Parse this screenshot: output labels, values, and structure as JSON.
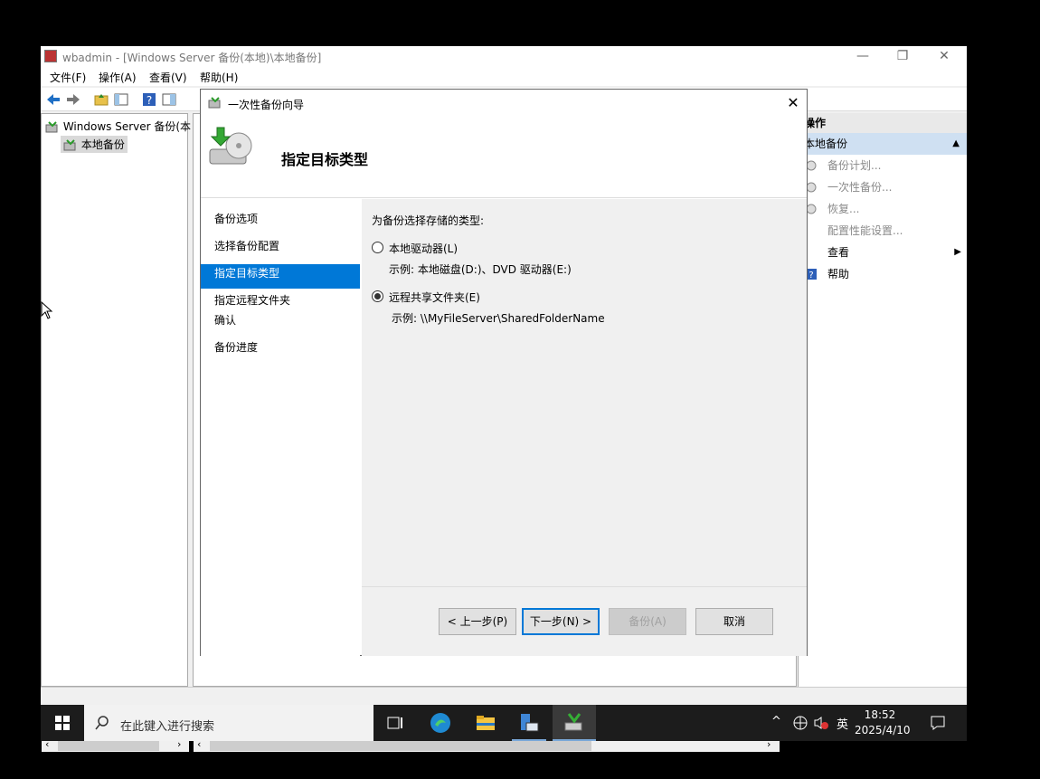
{
  "window": {
    "title": "wbadmin - [Windows Server 备份(本地)\\本地备份]",
    "minimize": "—",
    "restore": "❐",
    "close": "✕"
  },
  "menubar": [
    "文件(F)",
    "操作(A)",
    "查看(V)",
    "帮助(H)"
  ],
  "tree": {
    "root": "Windows Server 备份(本",
    "child": "本地备份"
  },
  "actions": {
    "header": "操作",
    "section": "本地备份",
    "items": [
      "备份计划...",
      "一次性备份...",
      "恢复...",
      "配置性能设置...",
      "查看",
      "帮助"
    ]
  },
  "dialog": {
    "title": "一次性备份向导",
    "heading": "指定目标类型",
    "steps": [
      "备份选项",
      "选择备份配置",
      "指定目标类型",
      "指定远程文件夹",
      "确认",
      "备份进度"
    ],
    "prompt": "为备份选择存储的类型:",
    "options": [
      {
        "label": "本地驱动器(L)",
        "example": "示例: 本地磁盘(D:)、DVD 驱动器(E:)",
        "selected": false
      },
      {
        "label": "远程共享文件夹(E)",
        "example": "示例: \\\\MyFileServer\\SharedFolderName",
        "selected": true
      }
    ],
    "buttons": {
      "prev": "< 上一步(P)",
      "next": "下一步(N) >",
      "backup": "备份(A)",
      "cancel": "取消"
    }
  },
  "taskbar": {
    "search_placeholder": "在此键入进行搜索",
    "time": "18:52",
    "date": "2025/4/10",
    "ime": "英"
  },
  "colors": {
    "accent": "#0078d7",
    "section_bg": "#cfe0f2"
  }
}
